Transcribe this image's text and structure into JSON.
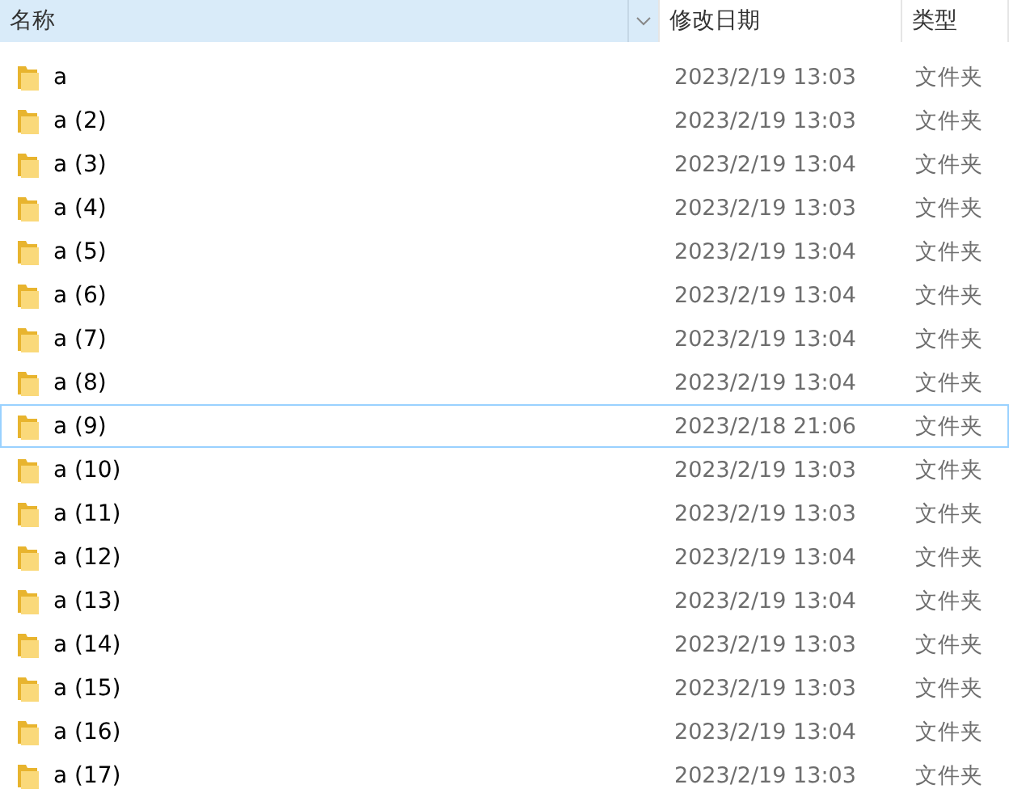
{
  "columns": [
    {
      "label": "名称",
      "sorted": true
    },
    {
      "label": "修改日期",
      "sorted": false
    },
    {
      "label": "类型",
      "sorted": false
    }
  ],
  "rows": [
    {
      "name": "a",
      "modified": "2023/2/19 13:03",
      "type": "文件夹",
      "focused": false
    },
    {
      "name": "a (2)",
      "modified": "2023/2/19 13:03",
      "type": "文件夹",
      "focused": false
    },
    {
      "name": "a (3)",
      "modified": "2023/2/19 13:04",
      "type": "文件夹",
      "focused": false
    },
    {
      "name": "a (4)",
      "modified": "2023/2/19 13:03",
      "type": "文件夹",
      "focused": false
    },
    {
      "name": "a (5)",
      "modified": "2023/2/19 13:04",
      "type": "文件夹",
      "focused": false
    },
    {
      "name": "a (6)",
      "modified": "2023/2/19 13:04",
      "type": "文件夹",
      "focused": false
    },
    {
      "name": "a (7)",
      "modified": "2023/2/19 13:04",
      "type": "文件夹",
      "focused": false
    },
    {
      "name": "a (8)",
      "modified": "2023/2/19 13:04",
      "type": "文件夹",
      "focused": false
    },
    {
      "name": "a (9)",
      "modified": "2023/2/18 21:06",
      "type": "文件夹",
      "focused": true
    },
    {
      "name": "a (10)",
      "modified": "2023/2/19 13:03",
      "type": "文件夹",
      "focused": false
    },
    {
      "name": "a (11)",
      "modified": "2023/2/19 13:03",
      "type": "文件夹",
      "focused": false
    },
    {
      "name": "a (12)",
      "modified": "2023/2/19 13:04",
      "type": "文件夹",
      "focused": false
    },
    {
      "name": "a (13)",
      "modified": "2023/2/19 13:04",
      "type": "文件夹",
      "focused": false
    },
    {
      "name": "a (14)",
      "modified": "2023/2/19 13:03",
      "type": "文件夹",
      "focused": false
    },
    {
      "name": "a (15)",
      "modified": "2023/2/19 13:03",
      "type": "文件夹",
      "focused": false
    },
    {
      "name": "a (16)",
      "modified": "2023/2/19 13:04",
      "type": "文件夹",
      "focused": false
    },
    {
      "name": "a (17)",
      "modified": "2023/2/19 13:03",
      "type": "文件夹",
      "focused": false
    }
  ]
}
